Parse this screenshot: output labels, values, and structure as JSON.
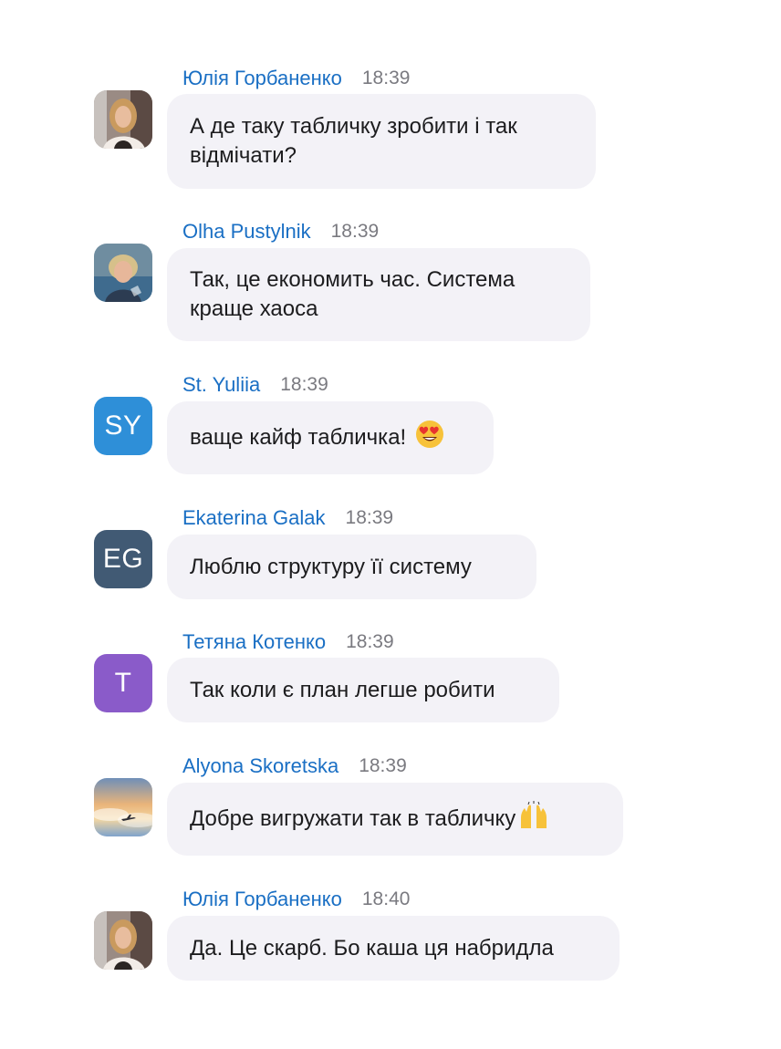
{
  "messages": [
    {
      "sender": "Юлія Горбаненко",
      "time": "18:39",
      "text_lines": [
        "А де таку табличку зробити і так",
        "відмічати?"
      ],
      "avatar": {
        "type": "photo",
        "icon": "woman-portrait-photo"
      }
    },
    {
      "sender": "Olha Pustylnik",
      "time": "18:39",
      "text_lines": [
        "Так, це економить час. Система",
        "краще хаоса"
      ],
      "avatar": {
        "type": "photo",
        "icon": "woman-portrait-photo"
      }
    },
    {
      "sender": "St. Yuliia",
      "time": "18:39",
      "text": "ваще кайф табличка!",
      "emoji": "heart-eyes-emoji",
      "avatar": {
        "type": "initials",
        "initials": "SY",
        "color": "#2e8fd8"
      }
    },
    {
      "sender": "Ekaterina Galak",
      "time": "18:39",
      "text": "Люблю структуру її систему",
      "avatar": {
        "type": "initials",
        "initials": "EG",
        "color": "#415a74"
      }
    },
    {
      "sender": "Тетяна Котенко",
      "time": "18:39",
      "text": "Так коли є план легше робити",
      "avatar": {
        "type": "initials",
        "initials": "T",
        "color": "#8a5bc9"
      }
    },
    {
      "sender": "Alyona Skoretska",
      "time": "18:39",
      "text": "Добре вигружати так в табличку",
      "emoji": "raising-hands-emoji",
      "avatar": {
        "type": "photo",
        "icon": "sky-airplane-photo"
      }
    },
    {
      "sender": "Юлія Горбаненко",
      "time": "18:40",
      "text": "Да. Це скарб. Бо каша ця набридла",
      "avatar": {
        "type": "photo",
        "icon": "woman-portrait-photo"
      }
    }
  ]
}
